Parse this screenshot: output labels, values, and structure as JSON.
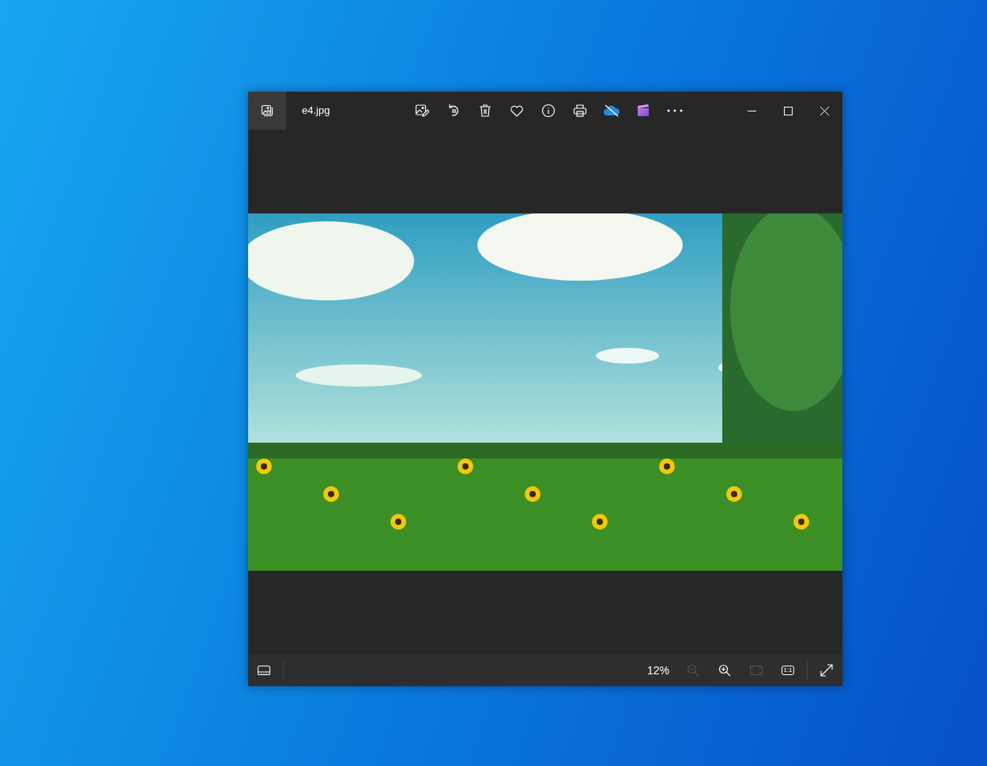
{
  "window": {
    "title": "e4.jpg"
  },
  "toolbar": [
    {
      "kind": "edit"
    },
    {
      "kind": "rotate"
    },
    {
      "kind": "delete"
    },
    {
      "kind": "favorite"
    },
    {
      "kind": "info"
    },
    {
      "kind": "print"
    },
    {
      "kind": "cloud"
    },
    {
      "kind": "video"
    },
    {
      "kind": "more"
    }
  ],
  "bottom_bar": {
    "zoom": "12%",
    "tools": [
      {
        "kind": "zoom-out",
        "disabled": true
      },
      {
        "kind": "zoom-in",
        "disabled": false
      },
      {
        "kind": "fit",
        "disabled": true
      },
      {
        "kind": "actual-size",
        "label": "1:1",
        "disabled": false
      }
    ]
  }
}
